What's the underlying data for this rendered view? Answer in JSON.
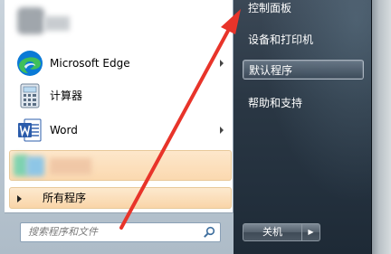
{
  "left_panel": {
    "programs": [
      {
        "label": "",
        "icon": "blurred-app-icon",
        "has_submenu": false
      },
      {
        "label": "Microsoft Edge",
        "icon": "edge-icon",
        "has_submenu": true
      },
      {
        "label": "计算器",
        "icon": "calculator-icon",
        "has_submenu": false
      },
      {
        "label": "Word",
        "icon": "word-icon",
        "has_submenu": true
      },
      {
        "label": "",
        "icon": "blurred-app-icon",
        "has_submenu": false,
        "highlighted": true
      }
    ],
    "all_programs_label": "所有程序",
    "search": {
      "placeholder": "搜索程序和文件",
      "value": ""
    }
  },
  "right_panel": {
    "items": [
      {
        "label": "控制面板",
        "selected": false
      },
      {
        "label": "设备和打印机",
        "selected": false
      },
      {
        "label": "默认程序",
        "selected": true
      },
      {
        "label": "帮助和支持",
        "selected": false
      }
    ],
    "shutdown_label": "关机",
    "shutdown_arrow_glyph": "▶"
  },
  "annotation": {
    "type": "red-arrow",
    "color": "#e8342a",
    "points_to": "控制面板"
  },
  "colors": {
    "highlight": "#fbd9b0",
    "edge_blue": "#0a7ad6",
    "edge_green": "#3fbf5a",
    "word_blue": "#2b5cab",
    "arrow_red": "#e8342a"
  }
}
